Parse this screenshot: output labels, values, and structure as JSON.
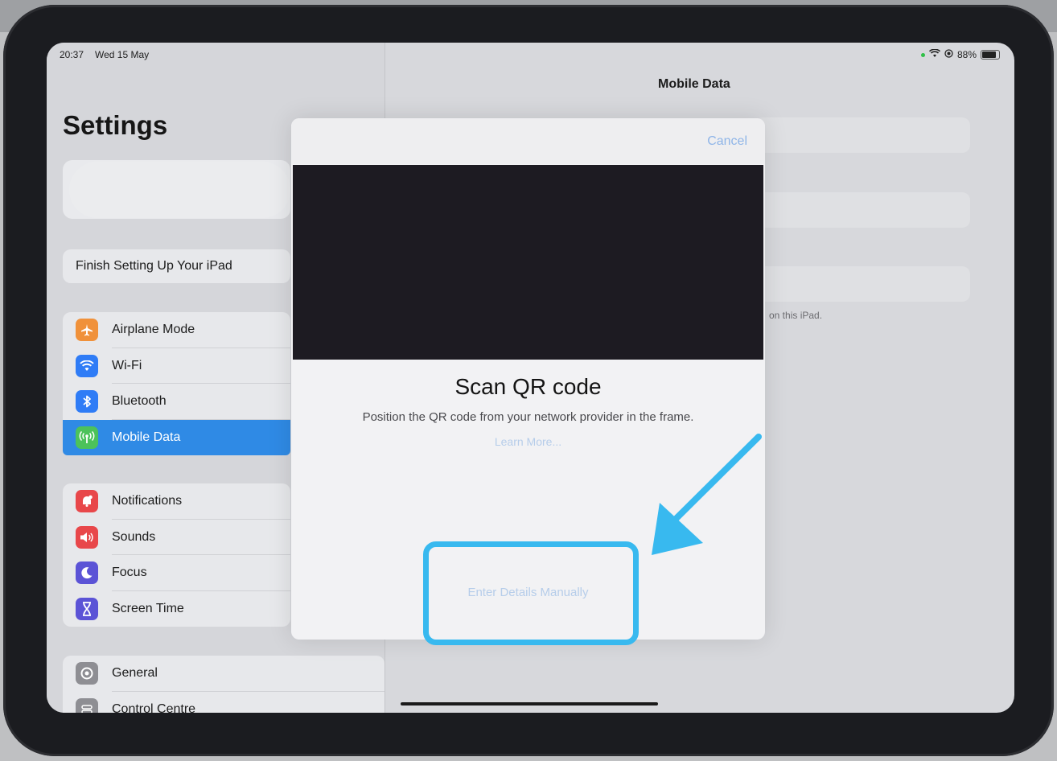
{
  "status_bar": {
    "time": "20:37",
    "date": "Wed 15 May",
    "battery": "88%"
  },
  "sidebar": {
    "title": "Settings",
    "finish_setup": "Finish Setting Up Your iPad",
    "group1": [
      {
        "label": "Airplane Mode",
        "icon": "airplane-icon",
        "color": "#f0913a"
      },
      {
        "label": "Wi-Fi",
        "icon": "wifi-icon",
        "color": "#2f7cf6"
      },
      {
        "label": "Bluetooth",
        "icon": "bluetooth-icon",
        "color": "#2f7cf6"
      },
      {
        "label": "Mobile Data",
        "icon": "antenna-icon",
        "color": "#4cc25a",
        "selected": true
      }
    ],
    "group2": [
      {
        "label": "Notifications",
        "icon": "bell-icon",
        "color": "#e8474a"
      },
      {
        "label": "Sounds",
        "icon": "speaker-icon",
        "color": "#e8474a"
      },
      {
        "label": "Focus",
        "icon": "moon-icon",
        "color": "#5b53d6"
      },
      {
        "label": "Screen Time",
        "icon": "hourglass-icon",
        "color": "#5b53d6"
      }
    ],
    "group3": [
      {
        "label": "General",
        "icon": "gear-icon",
        "color": "#8e8e93"
      },
      {
        "label": "Control Centre",
        "icon": "switches-icon",
        "color": "#8e8e93"
      }
    ]
  },
  "detail": {
    "title": "Mobile Data",
    "note": "on this iPad."
  },
  "modal": {
    "cancel": "Cancel",
    "title": "Scan QR code",
    "subtitle": "Position the QR code from your network provider in the frame.",
    "learn_more": "Learn More...",
    "enter_manually": "Enter Details Manually"
  },
  "annotation": {
    "highlight_color": "#38b9ef"
  }
}
